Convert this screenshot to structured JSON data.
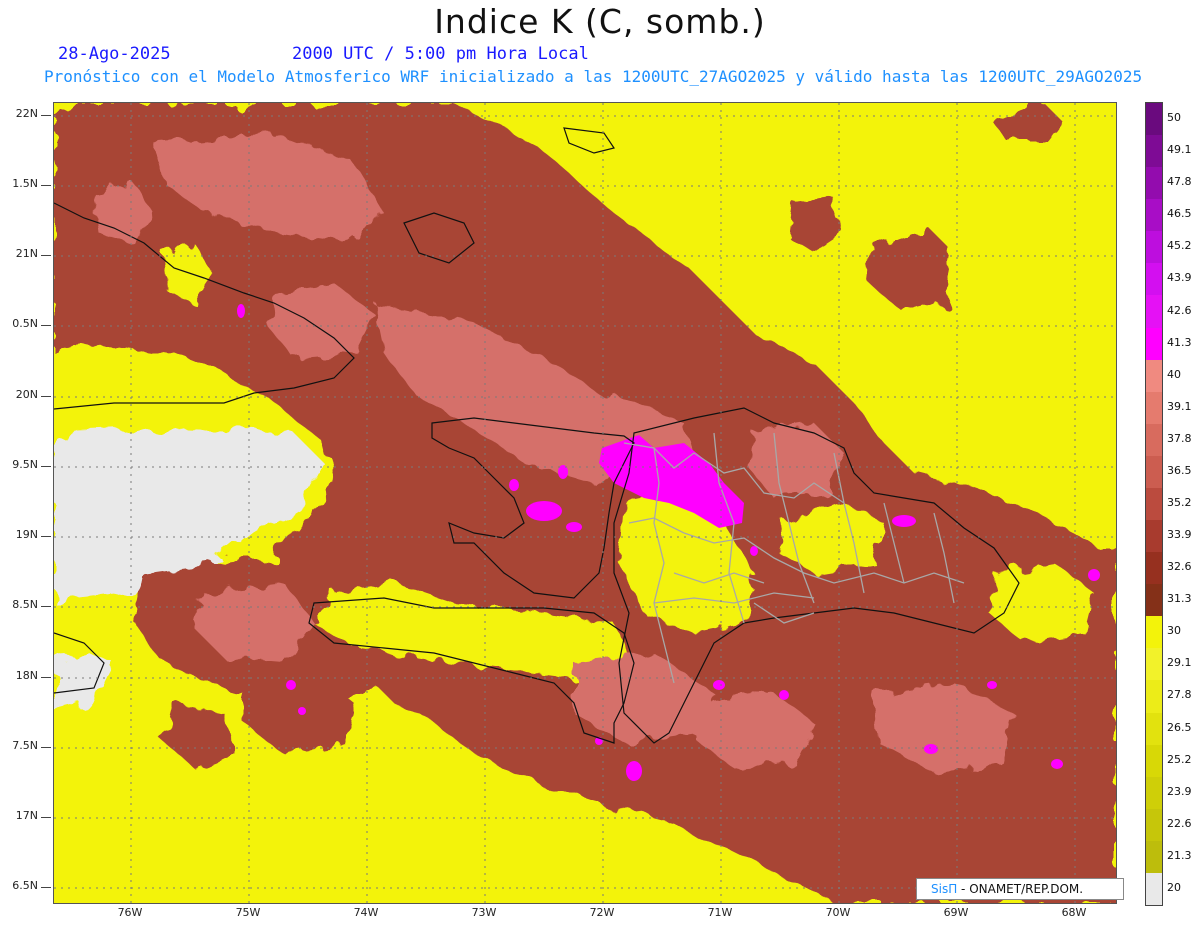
{
  "title": "Indice K (C, somb.)",
  "date": "28-Ago-2025",
  "time": "2000 UTC / 5:00 pm Hora Local",
  "subtitle": "Pronóstico con el Modelo Atmosferico WRF inicializado a las 1200UTC_27AGO2025 y válido hasta las  1200UTC_29AGO2025",
  "credit": {
    "brand": "SisΠ",
    "org": " - ONAMET/REP.DOM."
  },
  "lat_labels": [
    "22N",
    "1.5N",
    "21N",
    "0.5N",
    "20N",
    "9.5N",
    "19N",
    "8.5N",
    "18N",
    "7.5N",
    "17N",
    "6.5N"
  ],
  "lon_labels": [
    "76W",
    "75W",
    "74W",
    "73W",
    "72W",
    "71W",
    "70W",
    "69W",
    "68W"
  ],
  "colorbar": {
    "levels": [
      "50",
      "49.1",
      "47.8",
      "46.5",
      "45.2",
      "43.9",
      "42.6",
      "41.3",
      "40",
      "39.1",
      "37.8",
      "36.5",
      "35.2",
      "33.9",
      "32.6",
      "31.3",
      "30",
      "29.1",
      "27.8",
      "26.5",
      "25.2",
      "23.9",
      "22.6",
      "21.3",
      "20"
    ],
    "colors": [
      "#6a0a7e",
      "#7e0b95",
      "#930cae",
      "#a80dc6",
      "#bd0ede",
      "#d30ff0",
      "#e511f5",
      "#ff00ff",
      "#f08a80",
      "#e57b6e",
      "#d86b5e",
      "#cc5d50",
      "#bb4b3e",
      "#a83b2e",
      "#96301f",
      "#843018",
      "#f3f30a",
      "#f2f22a",
      "#ecec18",
      "#e2e20e",
      "#d8d806",
      "#cfcf08",
      "#c6c60a",
      "#bdbd0c",
      "#e9e9e9"
    ]
  },
  "map": {
    "region": "Hispaniola / Caribbean",
    "lon_range": [
      -76.6,
      -67.6
    ],
    "lat_range": [
      16.4,
      22.1
    ],
    "colors": {
      "land_gray": "#e9e9e9",
      "yellow": "#f3f30a",
      "brown": "#a84535",
      "salmon": "#d5706a",
      "magenta": "#ff00ff"
    }
  }
}
